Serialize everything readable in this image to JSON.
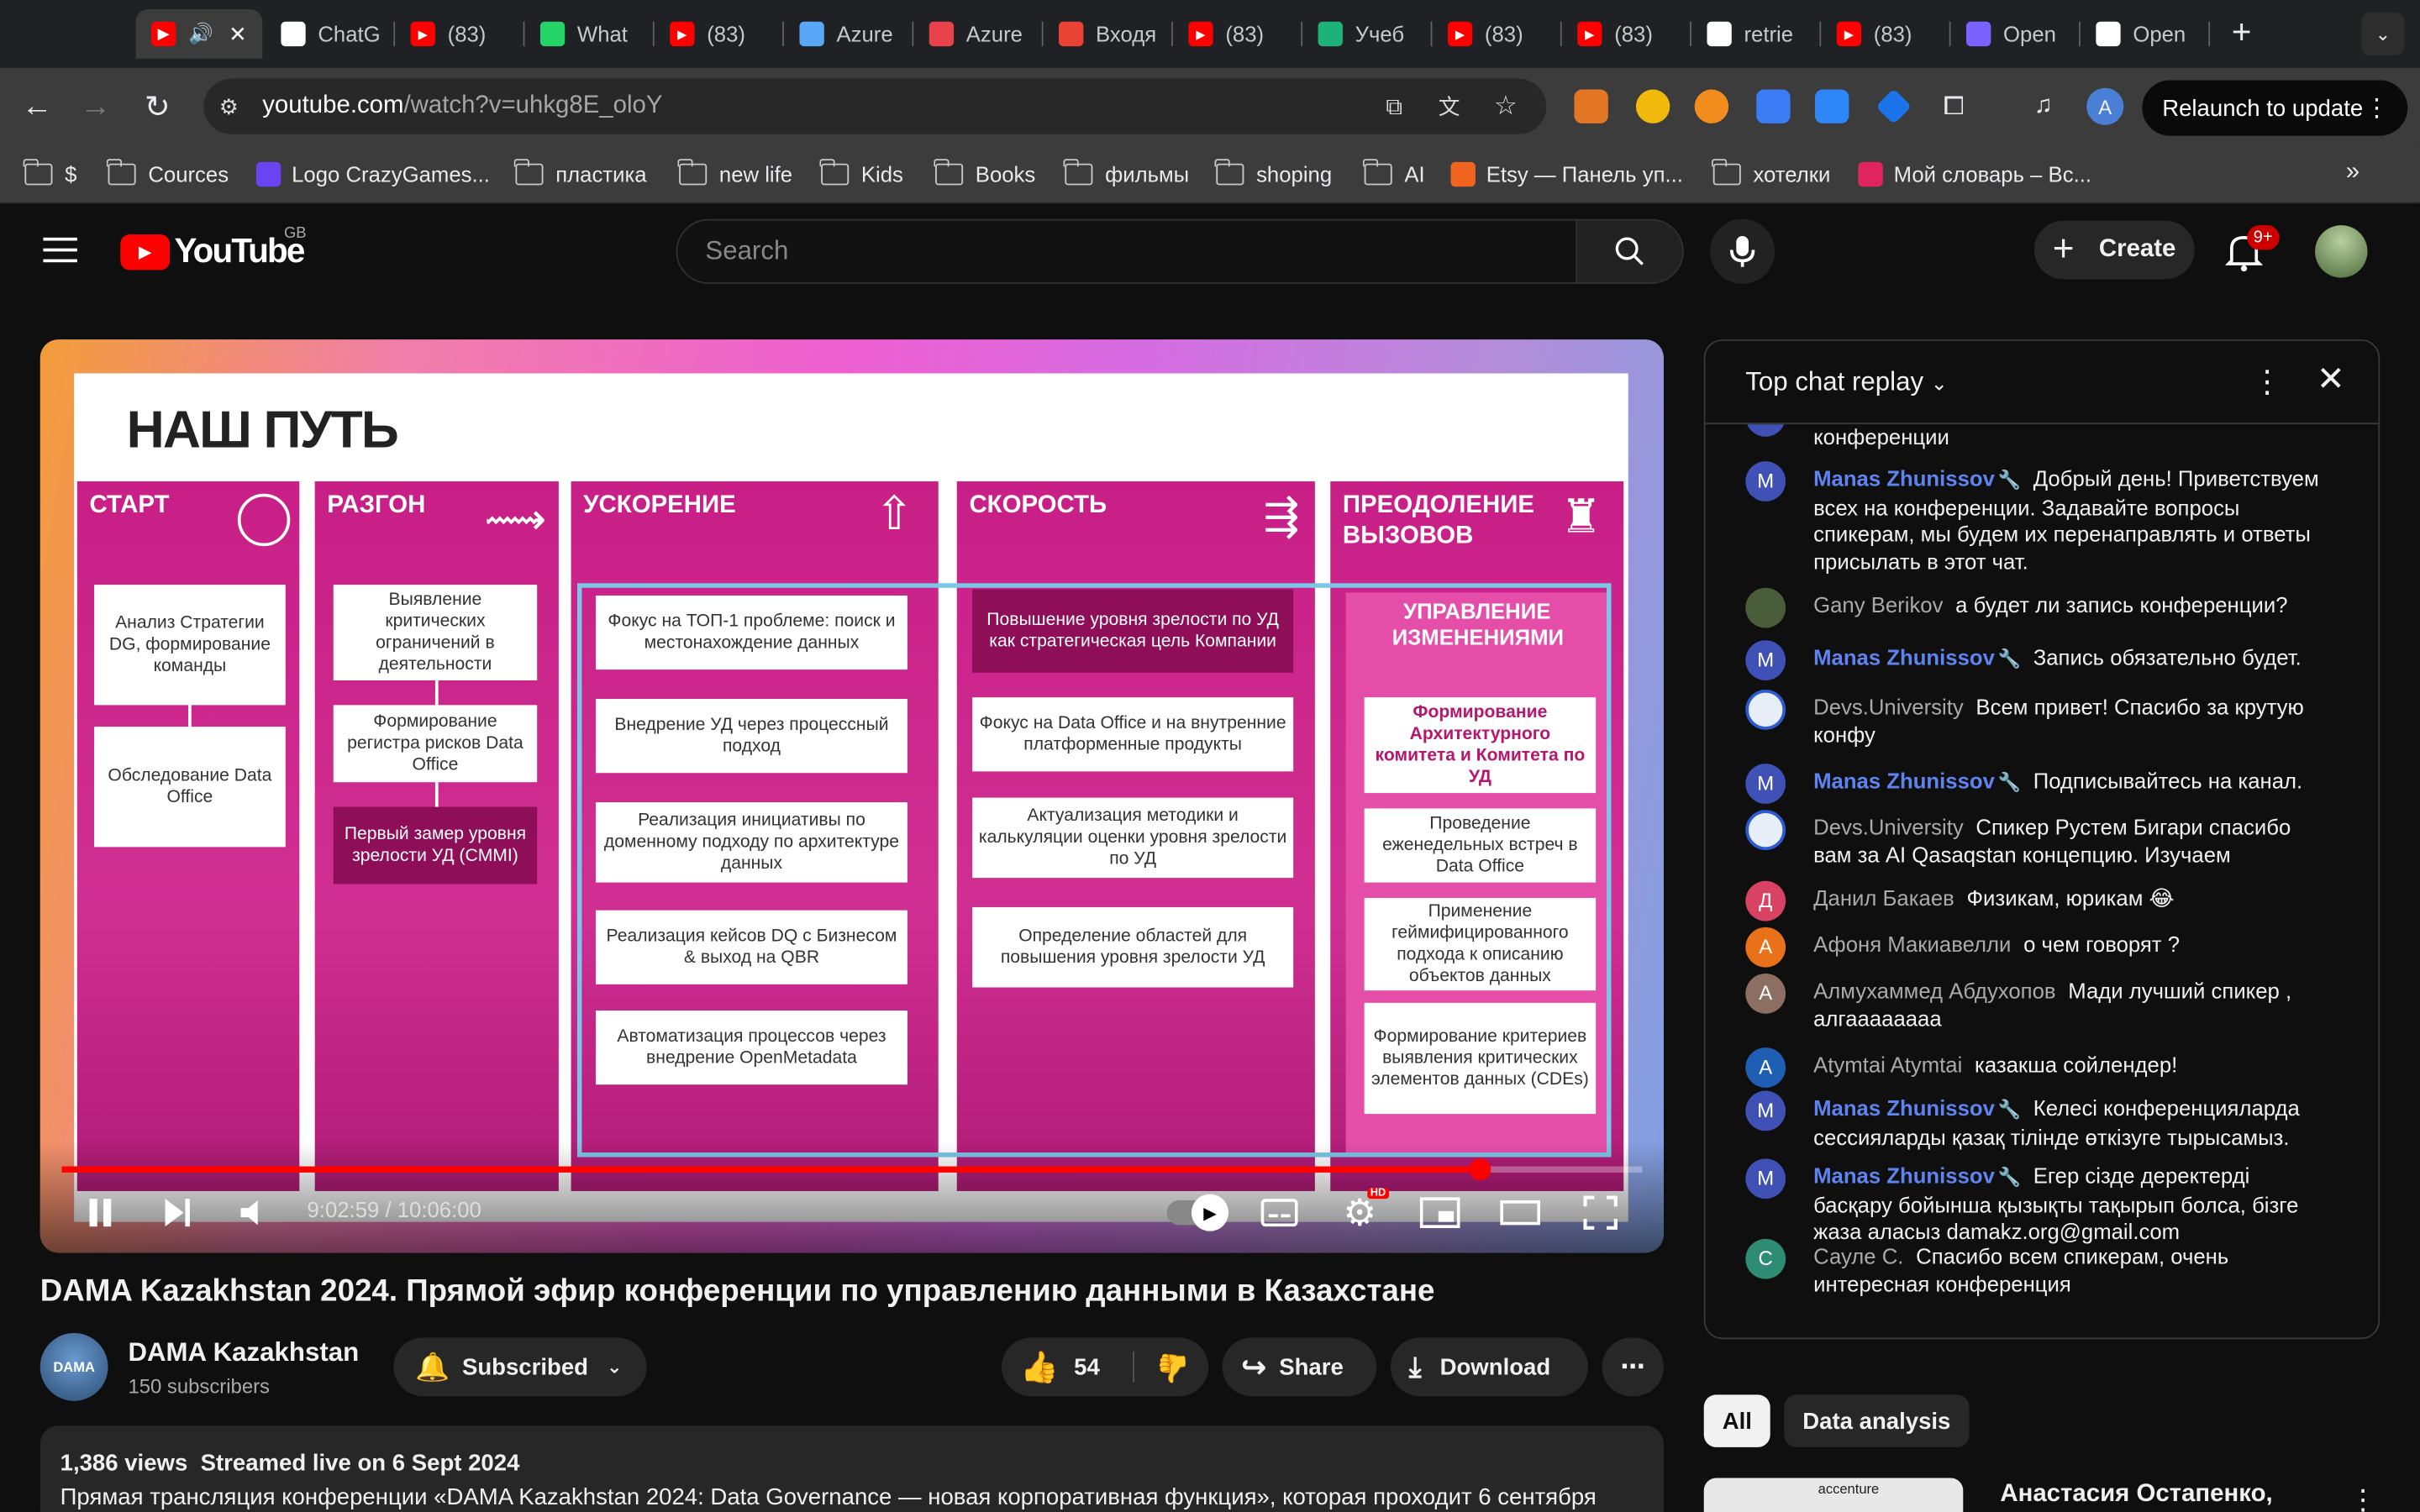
{
  "browser": {
    "tabs": [
      {
        "label": "",
        "icon": "youtube-icon"
      },
      {
        "label": "ChatG",
        "icon": "chatgpt-icon"
      },
      {
        "label": "(83)",
        "icon": "youtube-icon"
      },
      {
        "label": "What",
        "icon": "whatsapp-icon"
      },
      {
        "label": "(83)",
        "icon": "youtube-icon"
      },
      {
        "label": "Azure",
        "icon": "azure-icon"
      },
      {
        "label": "Azure",
        "icon": "azure-stack-icon"
      },
      {
        "label": "Входя",
        "icon": "gmail-icon"
      },
      {
        "label": "(83)",
        "icon": "youtube-icon"
      },
      {
        "label": "Учеб",
        "icon": "qualification-icon"
      },
      {
        "label": "(83)",
        "icon": "youtube-icon"
      },
      {
        "label": "(83)",
        "icon": "youtube-icon"
      },
      {
        "label": "retrie",
        "icon": "google-icon"
      },
      {
        "label": "(83)",
        "icon": "youtube-icon"
      },
      {
        "label": "Open",
        "icon": "openai-icon"
      },
      {
        "label": "Open",
        "icon": "google-icon"
      }
    ],
    "url_host": "youtube.com",
    "url_path": "/watch?v=uhkg8E_oloY",
    "relaunch_label": "Relaunch to update",
    "profile_initial": "A",
    "bookmarks": [
      {
        "label": "$",
        "type": "folder"
      },
      {
        "label": "Cources",
        "type": "folder"
      },
      {
        "label": "Logo CrazyGames...",
        "type": "site"
      },
      {
        "label": "пластика",
        "type": "folder"
      },
      {
        "label": "new life",
        "type": "folder"
      },
      {
        "label": "Kids",
        "type": "folder"
      },
      {
        "label": "Books",
        "type": "folder"
      },
      {
        "label": "фильмы",
        "type": "folder"
      },
      {
        "label": "shoping",
        "type": "folder"
      },
      {
        "label": "AI",
        "type": "folder"
      },
      {
        "label": "Etsy — Панель уп...",
        "type": "site"
      },
      {
        "label": "хотелки",
        "type": "folder"
      },
      {
        "label": "Мой словарь – Вс...",
        "type": "site"
      }
    ]
  },
  "youtube": {
    "logo_text": "YouTube",
    "region": "GB",
    "search_placeholder": "Search",
    "create_label": "Create",
    "notif_count": "9+"
  },
  "slide": {
    "title": "НАШ ПУТЬ",
    "columns": [
      {
        "heading": "СТАРТ",
        "boxes": [
          "Анализ Стратегии DG, формирование команды",
          "Обследование Data Office"
        ]
      },
      {
        "heading": "РАЗГОН",
        "boxes": [
          "Выявление критических ограничений в деятельности",
          "Формирование регистра рисков Data Office",
          "Первый замер уровня зрелости УД (CMMI)"
        ]
      },
      {
        "heading": "УСКОРЕНИЕ",
        "boxes": [
          "Фокус на ТОП-1 проблеме: поиск и местонахождение данных",
          "Внедрение УД через процессный подход",
          "Реализация инициативы по доменному подходу по архитектуре данных",
          "Реализация кейсов DQ с Бизнесом & выход на QBR",
          "Автоматизация процессов через внедрение OpenMetadata"
        ]
      },
      {
        "heading": "СКОРОСТЬ",
        "boxes": [
          "Повышение уровня зрелости по УД как стратегическая цель Компании",
          "Фокус на Data Office и на внутренние платформенные продукты",
          "Актуализация методики и калькуляции оценки уровня зрелости по УД",
          "Определение областей для повышения уровня зрелости УД"
        ]
      },
      {
        "heading": "ПРЕОДОЛЕНИЕ ВЫЗОВОВ",
        "sub": "УПРАВЛЕНИЕ ИЗМЕНЕНИЯМИ",
        "boxes": [
          "Формирование Архитектурного комитета и Комитета по УД",
          "Проведение еженедельных встреч в Data Office",
          "Применение геймифицированного подхода к описанию объектов данных",
          "Формирование критериев выявления критических элементов данных (CDEs)"
        ]
      }
    ]
  },
  "player": {
    "time": "9:02:59 / 10:06:00",
    "progress_fraction": 0.8978,
    "hd_badge": "HD"
  },
  "video": {
    "title": "DAMA Kazakhstan 2024. Прямой эфир конференции по управлению данными в Казахстане",
    "channel": "DAMA Kazakhstan",
    "channel_avatar_text": "DAMA",
    "subscribers": "150 subscribers",
    "subscribed_label": "Subscribed",
    "likes": "54",
    "share_label": "Share",
    "download_label": "Download",
    "views": "1,386 views",
    "streamed": "Streamed live on 6 Sept 2024",
    "description": "Прямая трансляция конференции «DAMA Kazakhstan 2024: Data Governance — новая корпоративная функция», которая проходит 6 сентября"
  },
  "chat": {
    "header": "Top chat replay",
    "partial_top": "конференции",
    "messages": [
      {
        "author": "Manas Zhunissov",
        "mod": true,
        "initial": "M",
        "color": "#3f51b5",
        "text": "Добрый день! Приветствуем всех на конференции. Задавайте вопросы спикерам, мы будем их перенаправлять и ответы присылать в этот чат."
      },
      {
        "author": "Gany Berikov",
        "mod": false,
        "initial": "",
        "color": "#4a5d3a",
        "text": "а будет ли запись конференции?"
      },
      {
        "author": "Manas Zhunissov",
        "mod": true,
        "initial": "M",
        "color": "#3f51b5",
        "text": "Запись обязательно будет."
      },
      {
        "author": "Devs.University",
        "mod": false,
        "initial": "",
        "color": "#e8eef8",
        "text": "Всем привет! Спасибо за крутую конфу"
      },
      {
        "author": "Manas Zhunissov",
        "mod": true,
        "initial": "M",
        "color": "#3f51b5",
        "text": "Подписывайтесь на канал."
      },
      {
        "author": "Devs.University",
        "mod": false,
        "initial": "",
        "color": "#e8eef8",
        "text": "Спикер Рустем Бигари спасибо вам за AI Qasaqstan концепцию. Изучаем"
      },
      {
        "author": "Данил Бакаев",
        "mod": false,
        "initial": "Д",
        "color": "#d84363",
        "text": "Физикам, юрикам 😂"
      },
      {
        "author": "Афоня Макиавелли",
        "mod": false,
        "initial": "А",
        "color": "#e8711a",
        "text": "о чем говорят ?"
      },
      {
        "author": "Алмухаммед Абдухопов",
        "mod": false,
        "initial": "А",
        "color": "#8d6e63",
        "text": "Мади лучший спикер , алгаааааааа"
      },
      {
        "author": "Atymtai Atymtai",
        "mod": false,
        "initial": "A",
        "color": "#1e5fb4",
        "text": "казакша сойлендер!"
      },
      {
        "author": "Manas Zhunissov",
        "mod": true,
        "initial": "M",
        "color": "#3f51b5",
        "text": "Келесі конференцияларда сессияларды қазақ тілінде өткізуге тырысамыз."
      },
      {
        "author": "Manas Zhunissov",
        "mod": true,
        "initial": "M",
        "color": "#3f51b5",
        "text": "Егер сізде деректерді басқару бойынша қызықты тақырып болса, бізге жаза аласыз damakz.org@gmail.com"
      },
      {
        "author": "Сауле С.",
        "mod": false,
        "initial": "С",
        "color": "#2e8b74",
        "text": "Спасибо всем спикерам, очень интересная конференция"
      }
    ]
  },
  "chips": [
    "All",
    "Data analysis"
  ],
  "recommendation": {
    "title": "Анастасия Остапенко,",
    "thumb_text": "accenture"
  }
}
